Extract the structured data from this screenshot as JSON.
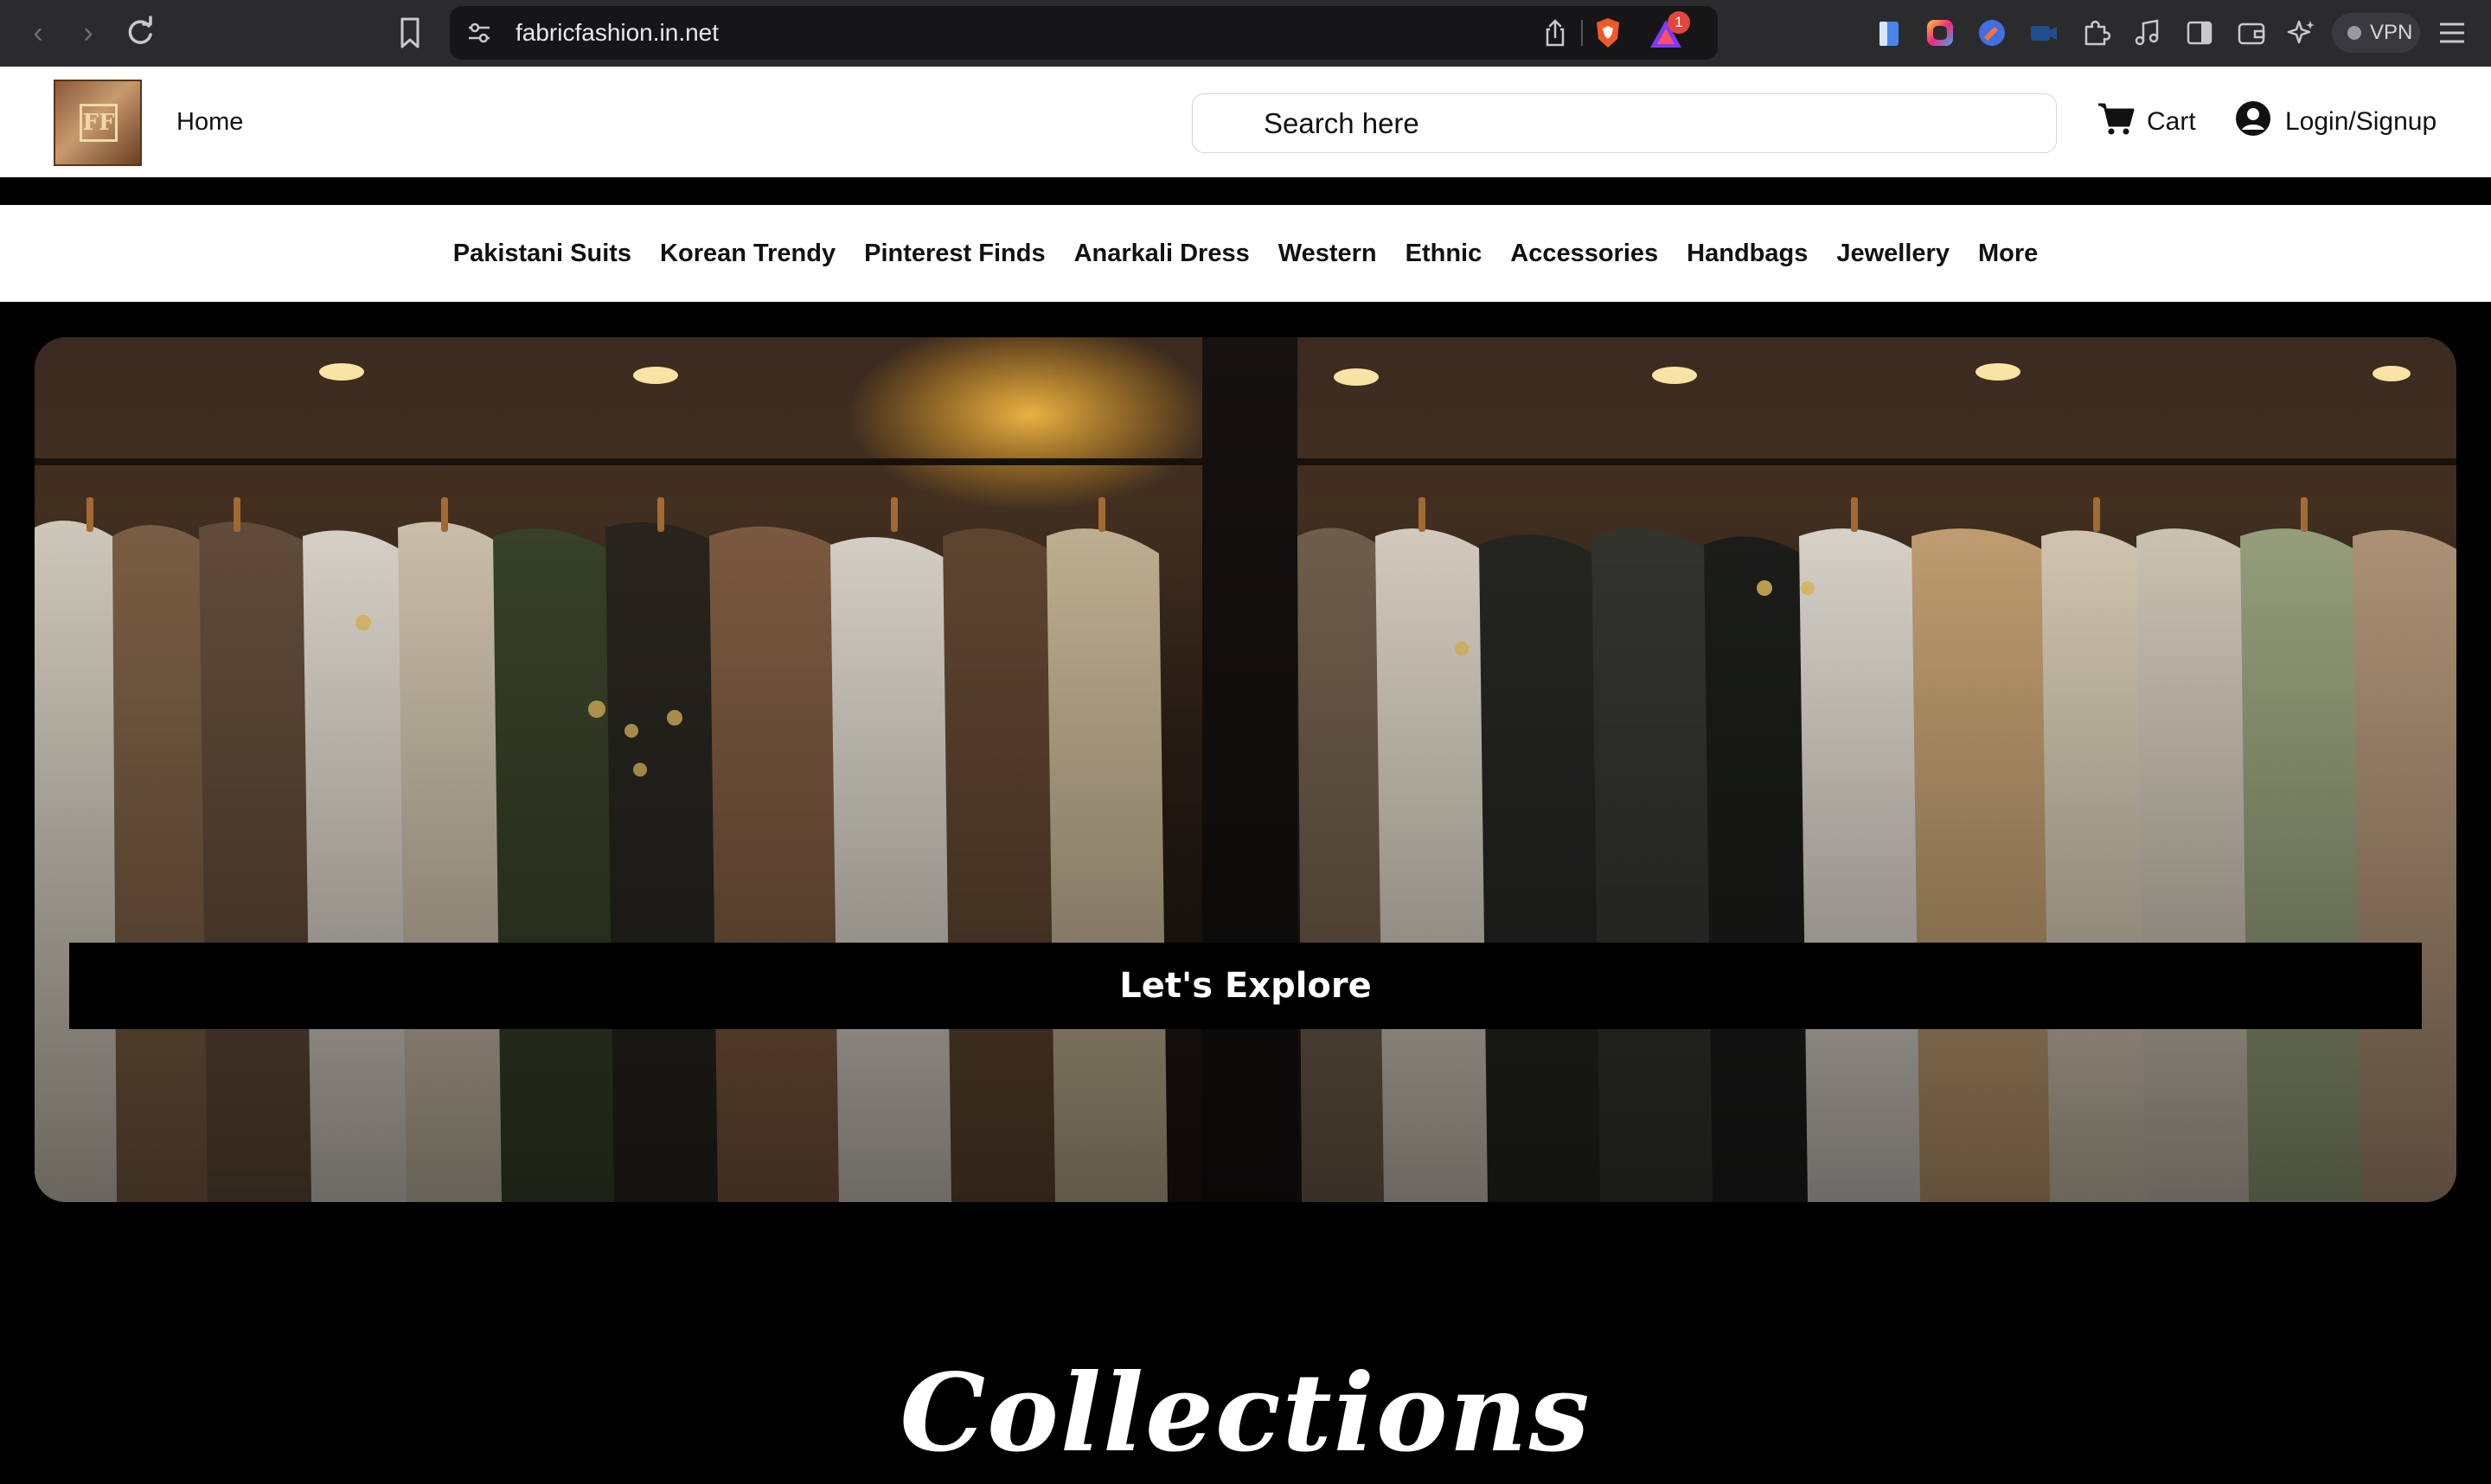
{
  "browser": {
    "url": "fabricfashion.in.net",
    "rewards_badge": "1",
    "vpn_label": "VPN"
  },
  "header": {
    "home_label": "Home",
    "search_placeholder": "Search here",
    "cart_label": "Cart",
    "login_label": "Login/Signup",
    "logo_text": "FF"
  },
  "categories": [
    "Pakistani Suits",
    "Korean Trendy",
    "Pinterest Finds",
    "Anarkali Dress",
    "Western",
    "Ethnic",
    "Accessories",
    "Handbags",
    "Jewellery",
    "More"
  ],
  "hero": {
    "cta_label": "Let's Explore"
  },
  "sections": {
    "collections_title": "Collections"
  },
  "colors": {
    "page_bg": "#000000",
    "header_bg": "#ffffff",
    "chrome_bg": "#2b2b2e",
    "accent_text": "#111111"
  }
}
